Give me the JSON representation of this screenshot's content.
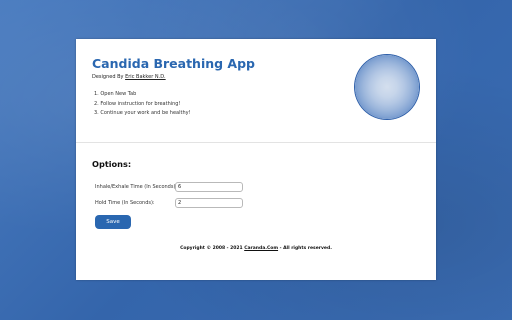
{
  "app": {
    "title": "Candida Breathing App",
    "designed_by_prefix": "Designed By ",
    "designer_name": "Eric Bakker N.D."
  },
  "instructions": [
    "1. Open New Tab",
    "2. Follow instruction for breathing!",
    "3. Continue your work and be healthy!"
  ],
  "breathing_circle": {
    "icon": "breathing-circle",
    "colors": {
      "center": "#d4dfee",
      "edge": "#2a5da8"
    }
  },
  "options": {
    "title": "Options:",
    "inhale_exhale_label": "Inhale/Exhale Time (In Seconds):",
    "inhale_exhale_value": "6",
    "hold_label": "Hold Time (In Seconds):",
    "hold_value": "2",
    "save_label": "Save"
  },
  "footer": {
    "copyright_prefix": "Copyright © 2008 - 2021 ",
    "site_link": "Caranda.Com",
    "copyright_suffix": " - All rights reserved."
  },
  "colors": {
    "accent": "#2a67b0",
    "background": "#3a6db2",
    "card": "#ffffff"
  }
}
